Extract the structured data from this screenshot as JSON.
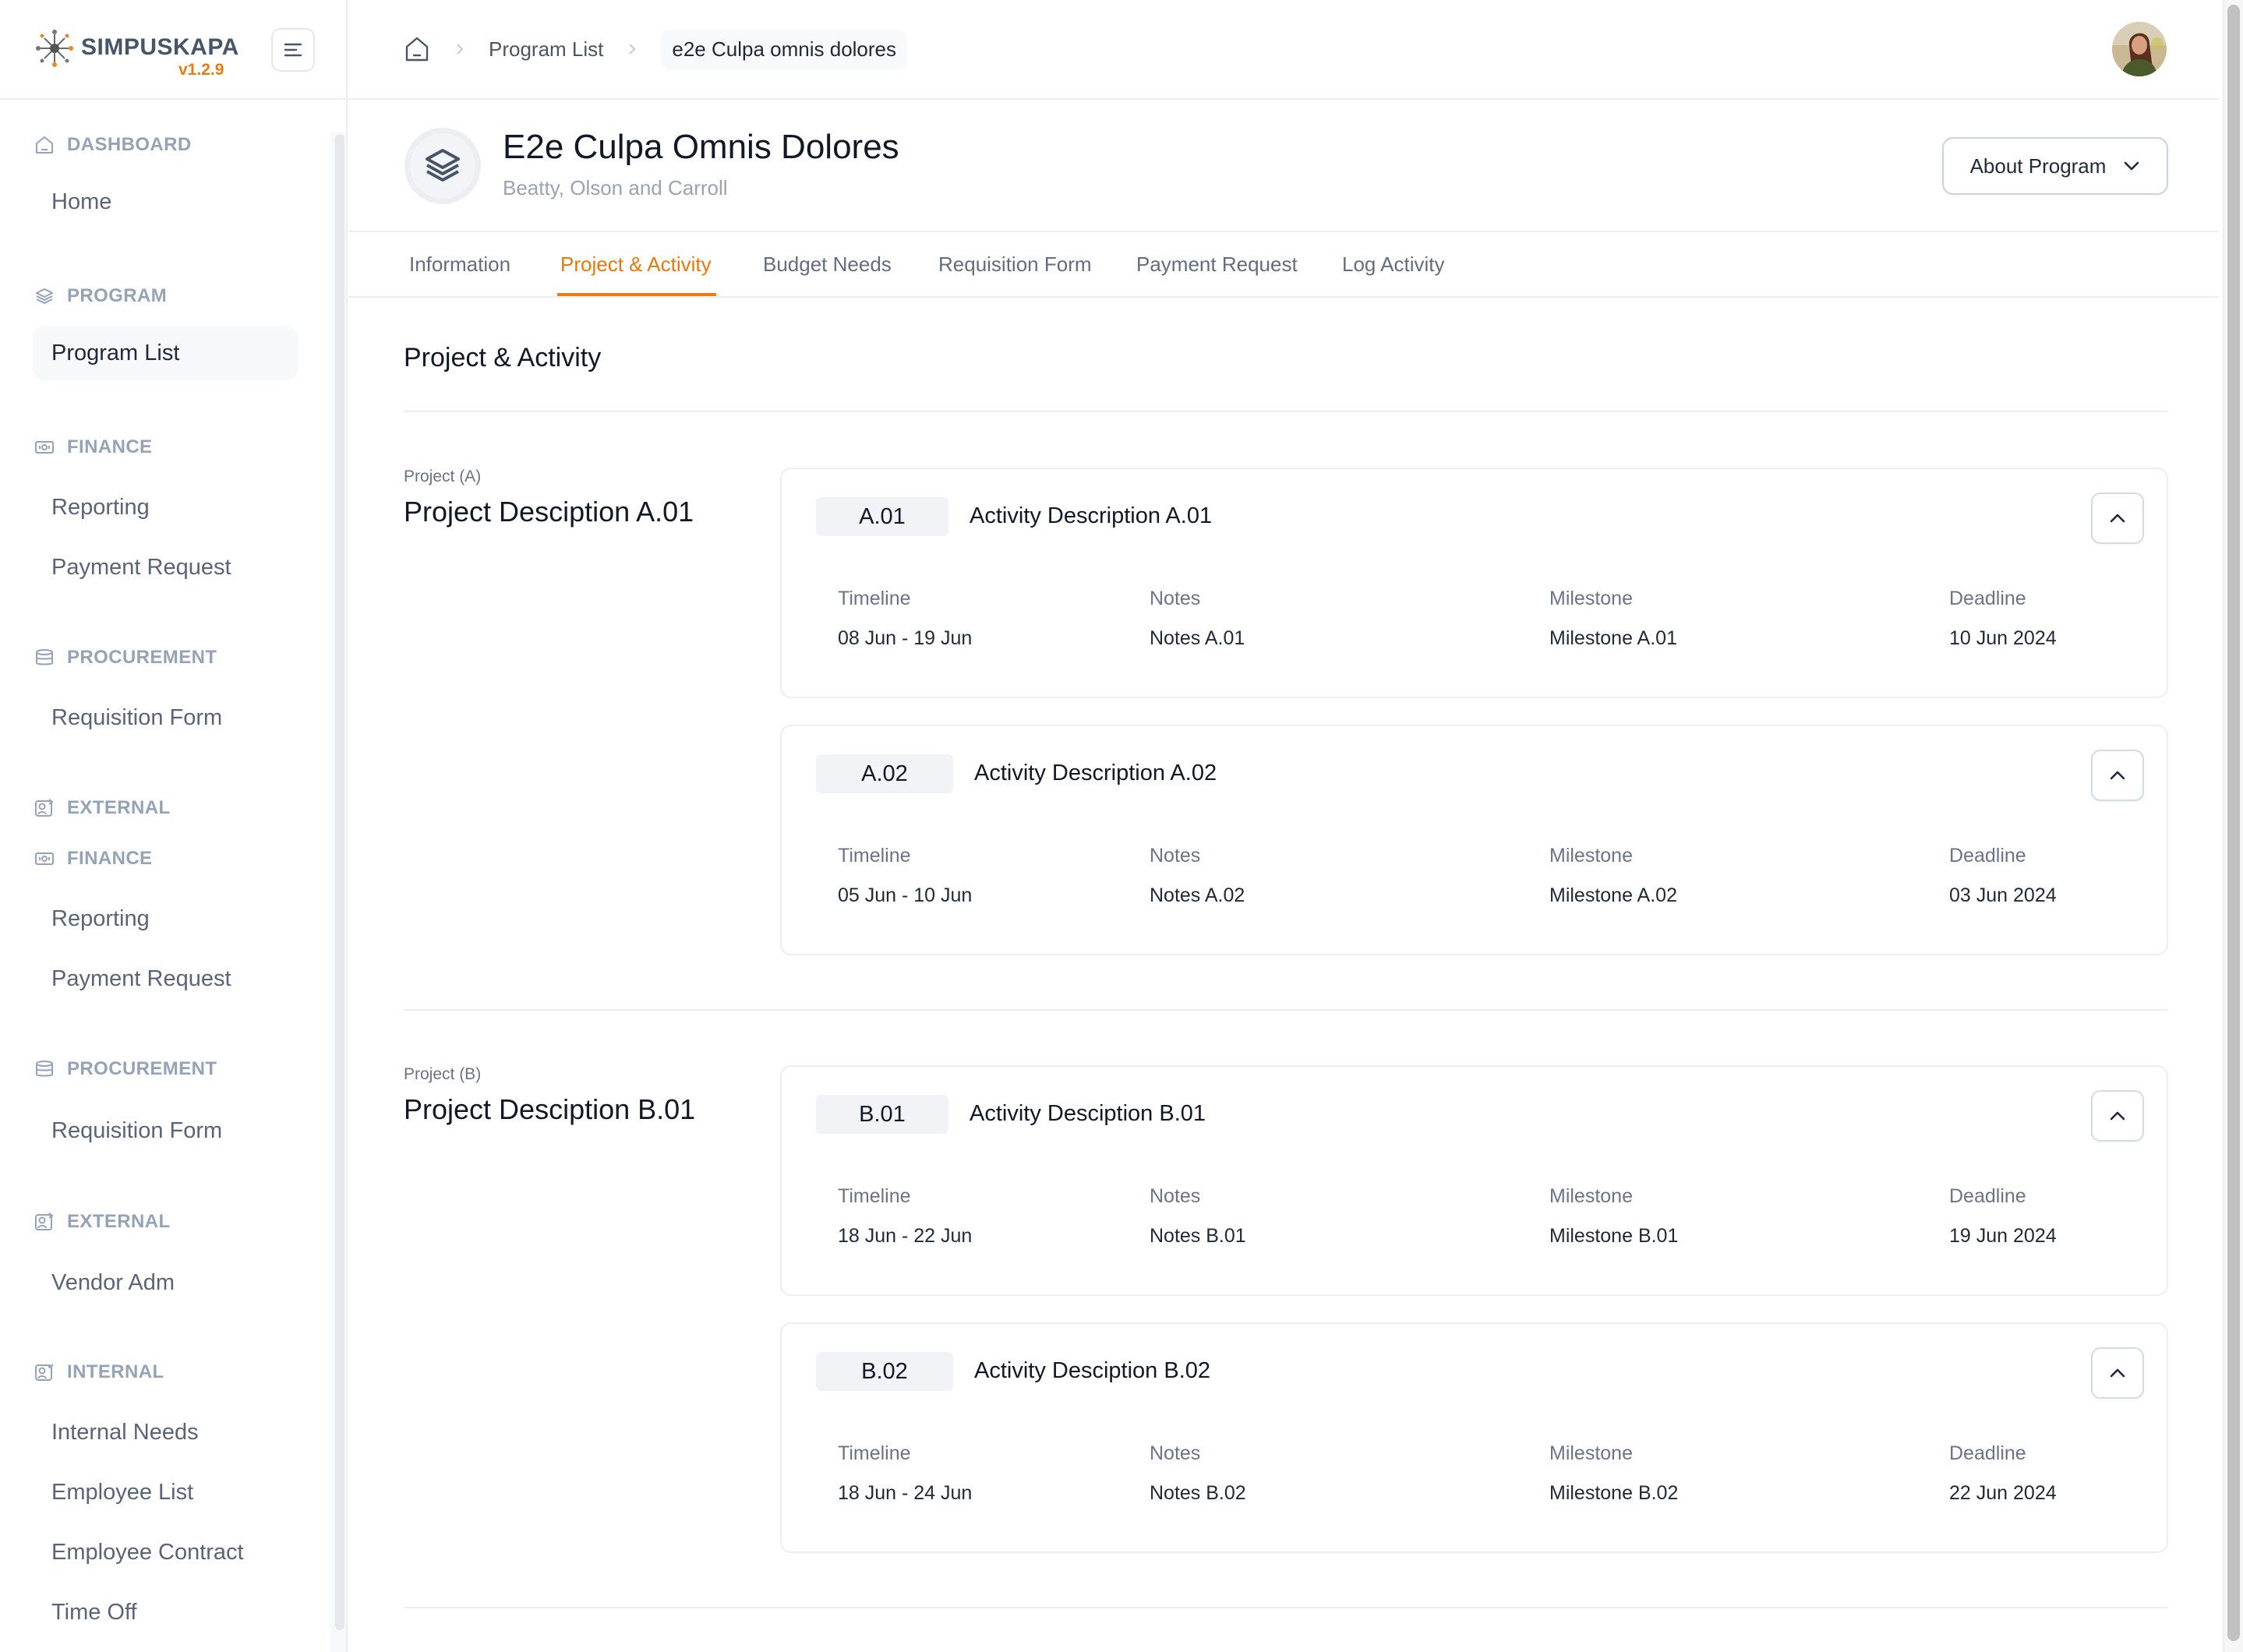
{
  "brand": {
    "name": "SIMPUSKAPA",
    "version": "v1.2.9",
    "accent": "#e57c14"
  },
  "sidebar": {
    "groups": [
      {
        "label": "DASHBOARD",
        "icon": "home-icon",
        "items": [
          "Home"
        ]
      },
      {
        "label": "PROGRAM",
        "icon": "layers-icon",
        "items": [
          "Program List"
        ]
      },
      {
        "label": "FINANCE",
        "icon": "banknote-icon",
        "items": [
          "Reporting",
          "Payment Request"
        ]
      },
      {
        "label": "PROCUREMENT",
        "icon": "database-icon",
        "items": [
          "Requisition Form"
        ]
      },
      {
        "label": "EXTERNAL",
        "icon": "user-share-icon",
        "items": []
      },
      {
        "label": "FINANCE",
        "icon": "banknote-icon",
        "items": [
          "Reporting",
          "Payment Request"
        ]
      },
      {
        "label": "PROCUREMENT",
        "icon": "database-icon",
        "items": [
          "Requisition Form"
        ]
      },
      {
        "label": "EXTERNAL",
        "icon": "user-share-icon",
        "items": [
          "Vendor Adm"
        ]
      },
      {
        "label": "INTERNAL",
        "icon": "user-check-icon",
        "items": [
          "Internal Needs",
          "Employee List",
          "Employee Contract",
          "Time Off"
        ]
      }
    ],
    "active_item": "Program List"
  },
  "breadcrumb": {
    "items": [
      "Program List"
    ],
    "current": "e2e Culpa omnis dolores"
  },
  "program": {
    "title": "E2e Culpa Omnis Dolores",
    "subtitle": "Beatty, Olson and Carroll",
    "about_button": "About Program"
  },
  "tabs": [
    {
      "label": "Information",
      "active": false
    },
    {
      "label": "Project & Activity",
      "active": true
    },
    {
      "label": "Budget Needs",
      "active": false
    },
    {
      "label": "Requisition Form",
      "active": false
    },
    {
      "label": "Payment Request",
      "active": false
    },
    {
      "label": "Log Activity",
      "active": false
    }
  ],
  "content": {
    "section_title": "Project & Activity",
    "field_labels": {
      "timeline": "Timeline",
      "notes": "Notes",
      "milestone": "Milestone",
      "deadline": "Deadline"
    },
    "projects": [
      {
        "label": "Project (A)",
        "description": "Project Desciption A.01",
        "activities": [
          {
            "code": "A.01",
            "description": "Activity Description A.01",
            "timeline": "08 Jun - 19 Jun",
            "notes": "Notes A.01",
            "milestone": "Milestone A.01",
            "deadline": "10 Jun 2024"
          },
          {
            "code": "A.02",
            "description": "Activity Description A.02",
            "timeline": "05 Jun - 10 Jun",
            "notes": "Notes A.02",
            "milestone": "Milestone A.02",
            "deadline": "03 Jun 2024"
          }
        ]
      },
      {
        "label": "Project (B)",
        "description": "Project Desciption B.01",
        "activities": [
          {
            "code": "B.01",
            "description": "Activity Desciption B.01",
            "timeline": "18 Jun - 22 Jun",
            "notes": "Notes B.01",
            "milestone": "Milestone B.01",
            "deadline": "19 Jun 2024"
          },
          {
            "code": "B.02",
            "description": "Activity Desciption B.02",
            "timeline": "18 Jun - 24 Jun",
            "notes": "Notes B.02",
            "milestone": "Milestone B.02",
            "deadline": "22 Jun 2024"
          }
        ]
      }
    ]
  }
}
